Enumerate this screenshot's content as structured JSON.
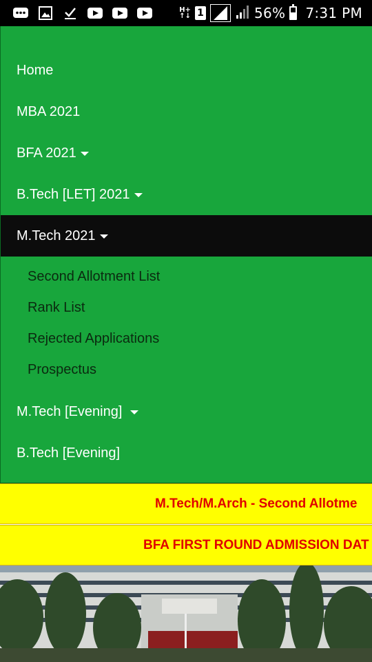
{
  "status_bar": {
    "battery_percent": "56%",
    "time": "7:31 PM",
    "network_label": "H+",
    "sim_label": "1",
    "battery_level": 0.56,
    "icons": [
      "message-icon",
      "gallery-icon",
      "check-download-icon",
      "youtube-icon",
      "youtube-icon",
      "youtube-icon"
    ]
  },
  "nav": {
    "items": [
      {
        "label": "Home",
        "dropdown": false
      },
      {
        "label": "MBA 2021",
        "dropdown": false
      },
      {
        "label": "BFA 2021",
        "dropdown": true
      },
      {
        "label": "B.Tech [LET] 2021",
        "dropdown": true
      },
      {
        "label": "M.Tech 2021",
        "dropdown": true,
        "active": true
      },
      {
        "label": "M.Tech [Evening] ",
        "dropdown": true
      },
      {
        "label": "B.Tech [Evening]",
        "dropdown": false
      }
    ],
    "submenu": [
      {
        "label": "Second Allotment List"
      },
      {
        "label": "Rank List"
      },
      {
        "label": "Rejected Applications"
      },
      {
        "label": "Prospectus"
      }
    ]
  },
  "tickers": [
    {
      "text": "M.Tech/M.Arch - Second Allotme"
    },
    {
      "text": "BFA FIRST ROUND ADMISSION DAT"
    }
  ],
  "colors": {
    "nav_bg": "#18a63c",
    "active_bg": "#0c0c0c",
    "ticker_bg": "#ffff00",
    "ticker_text": "#e00000"
  }
}
